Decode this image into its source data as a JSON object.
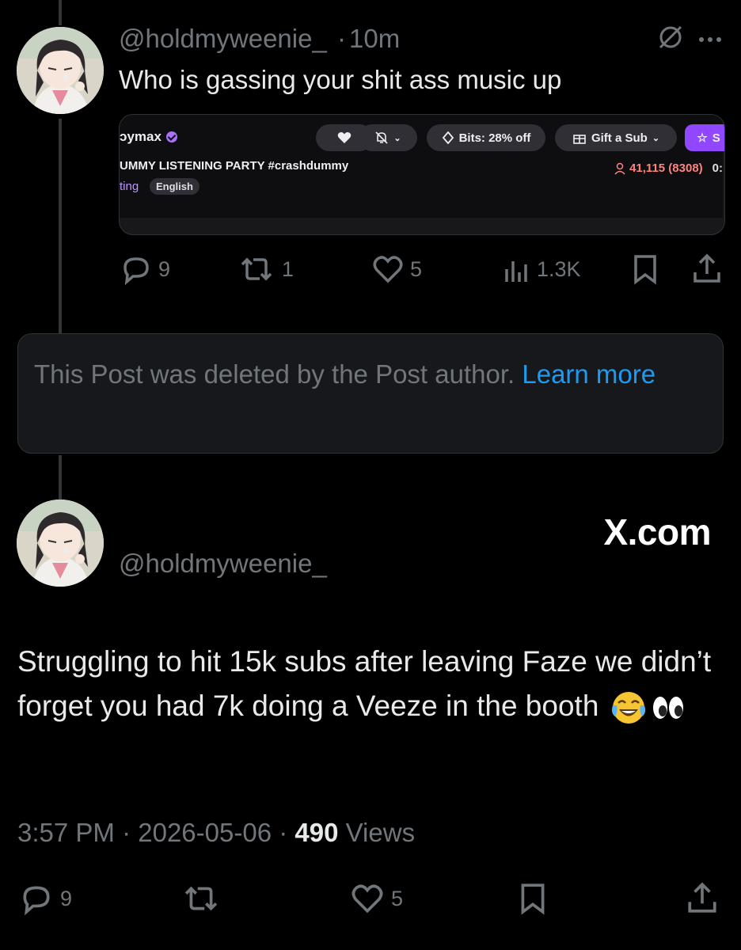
{
  "reply_tweet": {
    "handle": "@holdmyweenie_",
    "separator": "·",
    "time": "10m",
    "text": "Who is gassing your shit ass music up",
    "embed": {
      "channel_name": "ɔymax",
      "follow_icon": "heart-icon",
      "notify_icon": "bell-off-icon",
      "bits_label": "Bits: 28% off",
      "gift_label": "Gift a Sub",
      "sub_label": "S",
      "stream_title": "UMMY LISTENING PARTY #crashdummy",
      "category_fragment": "ting",
      "tag": "English",
      "viewers": "41,115 (8308)",
      "uptime": "0:"
    },
    "stats": {
      "replies": "9",
      "reposts": "1",
      "likes": "5",
      "views": "1.3K"
    }
  },
  "deleted_notice": {
    "text": "This Post was deleted by the Post author.",
    "link": "Learn more"
  },
  "main_tweet": {
    "watermark": "X.com",
    "handle": "@holdmyweenie_",
    "text": "Struggling to hit 15k subs after leaving Faze we didn’t forget you had 7k doing a Veeze in the booth",
    "emojis": [
      "face-with-tears-of-joy",
      "eyes"
    ],
    "time": "3:57 PM",
    "date": "2026-05-06",
    "views_count": "490",
    "views_label": "Views",
    "separator": "·",
    "stats": {
      "replies": "9",
      "likes": "5"
    }
  },
  "colors": {
    "background": "#000000",
    "text": "#e7e9ea",
    "muted": "#71767b",
    "link": "#1d9bf0",
    "twitch_purple": "#a970ff",
    "viewers_red": "#ff8280"
  }
}
